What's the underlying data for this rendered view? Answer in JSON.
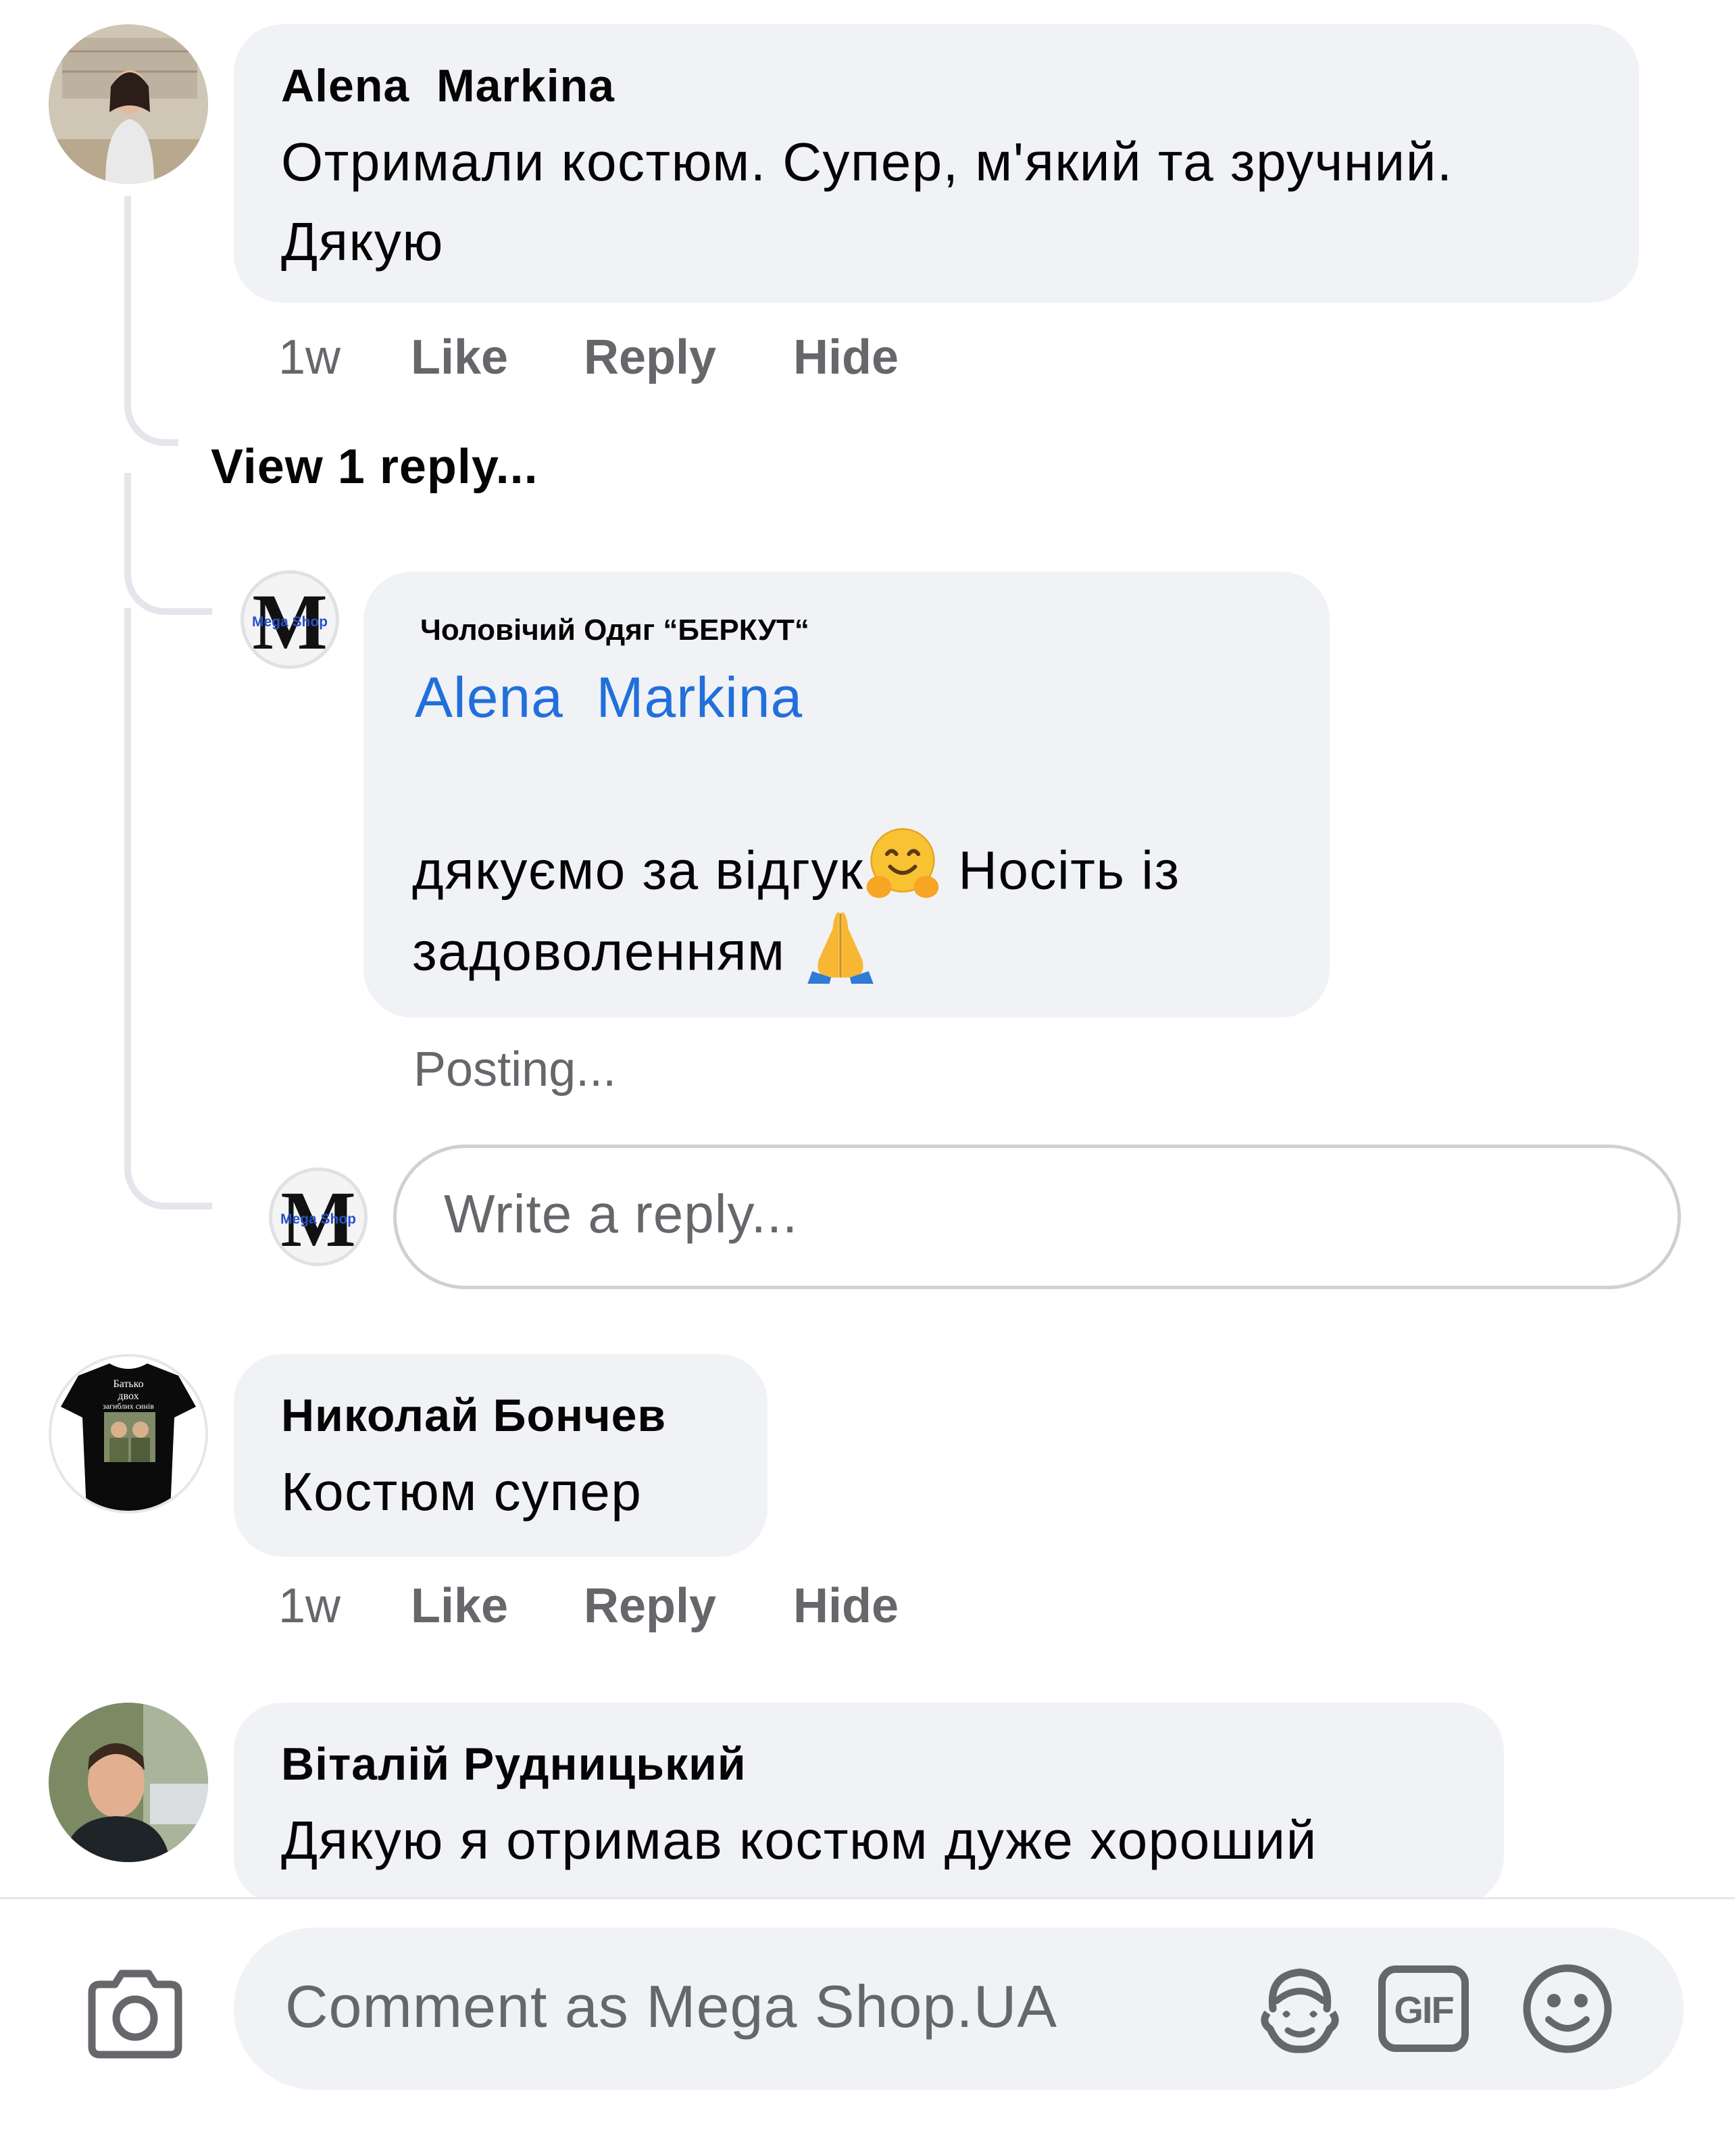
{
  "comments": [
    {
      "author": "Alena  Markina",
      "text_line1": "Отримали костюм. Супер, м'який та зручний.",
      "text_line2": "Дякую",
      "time": "1w",
      "like": "Like",
      "reply": "Reply",
      "hide": "Hide"
    },
    {
      "author": "Николай Бончев",
      "text": "Костюм супер",
      "time": "1w",
      "like": "Like",
      "reply": "Reply",
      "hide": "Hide",
      "avatar_shirt_text_1": "Батько",
      "avatar_shirt_text_2": "двох",
      "avatar_shirt_text_3": "загиблих синів"
    },
    {
      "author": "Віталій Рудницький",
      "text": "Дякую я отримав костюм дуже хороший"
    }
  ],
  "view_replies": "View 1 reply...",
  "page_reply": {
    "author": "Чоловічий Одяг “БЕРКУТ“",
    "mention": "Alena  Markina",
    "text_line1": "дякуємо за відгук",
    "text_line1_after": " Носіть із",
    "text_line2": "задоволенням ",
    "status": "Posting..."
  },
  "page_avatar": {
    "letter": "M",
    "label": "Mega Shop"
  },
  "reply_input": {
    "placeholder": "Write a reply..."
  },
  "composer": {
    "placeholder": "Comment as Mega Shop.UA",
    "gif_label": "GIF"
  },
  "icons": {
    "camera": "camera-icon",
    "avatar_sticker": "avatar-sticker-icon",
    "gif": "gif-icon",
    "emoji": "emoji-icon",
    "hug": "hugging-face-emoji",
    "pray": "folded-hands-emoji"
  },
  "colors": {
    "bubble": "#f0f2f5",
    "link": "#216fdb",
    "secondary_text": "#65676b",
    "thread_line": "#e4e6eb"
  }
}
